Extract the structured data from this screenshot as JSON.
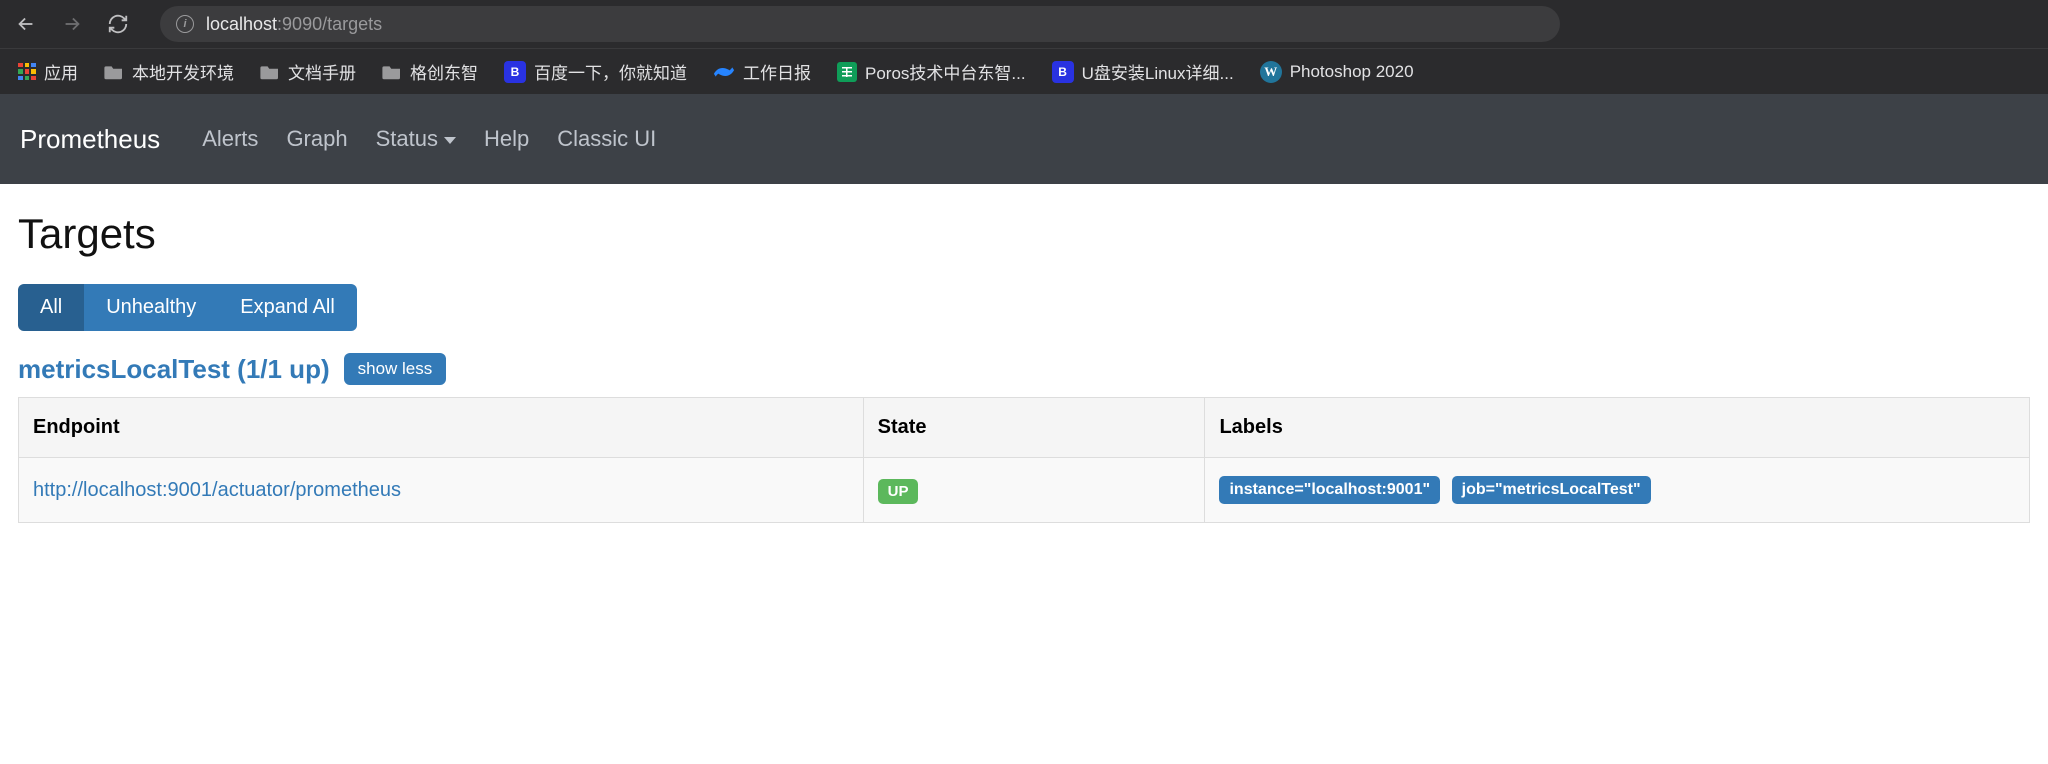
{
  "browser": {
    "url_host": "localhost",
    "url_port_path": ":9090/targets"
  },
  "bookmarks": {
    "apps": "应用",
    "local_dev": "本地开发环境",
    "docs": "文档手册",
    "gcdz": "格创东智",
    "baidu": "百度一下，你就知道",
    "work_log": "工作日报",
    "poros": "Poros技术中台东智...",
    "usb_linux": "U盘安装Linux详细...",
    "ps": "Photoshop 2020"
  },
  "nav": {
    "brand": "Prometheus",
    "alerts": "Alerts",
    "graph": "Graph",
    "status": "Status",
    "help": "Help",
    "classic": "Classic UI"
  },
  "page": {
    "title": "Targets",
    "filters": {
      "all": "All",
      "unhealthy": "Unhealthy",
      "expand_all": "Expand All"
    },
    "pool": {
      "name_with_count": "metricsLocalTest (1/1 up)",
      "toggle_label": "show less"
    },
    "headers": {
      "endpoint": "Endpoint",
      "state": "State",
      "labels": "Labels"
    },
    "rows": [
      {
        "endpoint": "http://localhost:9001/actuator/prometheus",
        "state": "UP",
        "labels": [
          "instance=\"localhost:9001\"",
          "job=\"metricsLocalTest\""
        ]
      }
    ]
  }
}
